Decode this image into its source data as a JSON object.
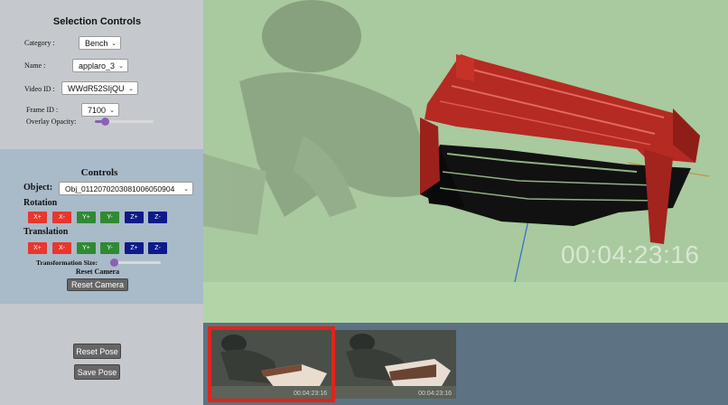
{
  "selection": {
    "title": "Selection Controls",
    "category_label": "Category :",
    "category_value": "Bench",
    "name_label": "Name :",
    "name_value": "applaro_3",
    "video_label": "Video ID :",
    "video_value": "WWdR52SIjQU",
    "frame_label": "Frame ID :",
    "frame_value": "7100",
    "opacity_label": "Overlay Opacity:",
    "opacity_level": 0.12
  },
  "controls": {
    "title": "Controls",
    "object_label": "Object:",
    "object_value": "Obj_011207020308100605090​4",
    "rotation_label": "Rotation",
    "translation_label": "Translation",
    "axis_buttons": [
      "X+",
      "X-",
      "Y+",
      "Y-",
      "Z+",
      "Z-"
    ],
    "transform_size_label": "Transformation Size:",
    "transform_size_level": 0.02,
    "reset_camera_label": "Reset Camera",
    "reset_camera_button": "Reset Camera"
  },
  "actions": {
    "reset_pose": "Reset Pose",
    "save_pose": "Save Pose"
  },
  "viewer": {
    "timestamp": "00:04:23:16"
  },
  "frames": [
    {
      "timestamp": "00:04:23:16",
      "selected": true
    },
    {
      "timestamp": "00:04:23:16",
      "selected": false
    }
  ],
  "colors": {
    "accent_slider": "#8e5fb5",
    "axis_x": "#e8372e",
    "axis_y": "#2f8a33",
    "axis_z": "#0e1a8a",
    "selected_frame_border": "#e0241b",
    "model_red": "#b52a22"
  }
}
